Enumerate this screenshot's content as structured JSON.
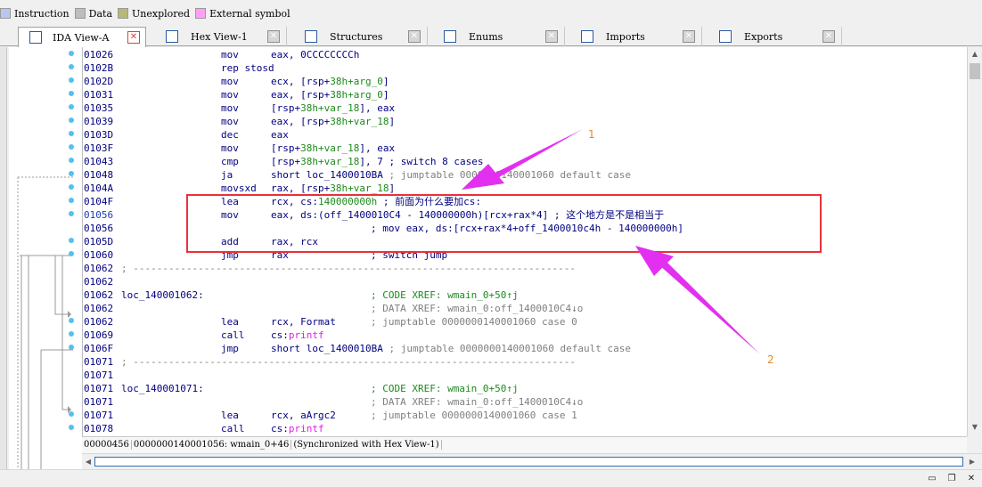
{
  "legend": [
    {
      "label": "Instruction",
      "color": "#b8c6f0"
    },
    {
      "label": "Data",
      "color": "#bdbdbd"
    },
    {
      "label": "Unexplored",
      "color": "#b8b878"
    },
    {
      "label": "External symbol",
      "color": "#ff9ff5"
    }
  ],
  "tabs": [
    {
      "label": "IDA View-A",
      "icon": "listing-icon",
      "active": true
    },
    {
      "label": "Hex View-1",
      "icon": "hex-icon",
      "active": false
    },
    {
      "label": "Structures",
      "icon": "structures-icon",
      "active": false
    },
    {
      "label": "Enums",
      "icon": "enums-icon",
      "active": false
    },
    {
      "label": "Imports",
      "icon": "imports-icon",
      "active": false
    },
    {
      "label": "Exports",
      "icon": "exports-icon",
      "active": false
    }
  ],
  "listing": {
    "rows": [
      {
        "addr": "01026",
        "mnem": "mov",
        "ops": "eax, 0CCCCCCCCh"
      },
      {
        "addr": "0102B",
        "mnem": "rep stosd",
        "ops": ""
      },
      {
        "addr": "0102D",
        "mnem": "mov",
        "ops_pre": "ecx, [rsp+",
        "ops_var": "38h+arg_0",
        "ops_post": "]"
      },
      {
        "addr": "01031",
        "mnem": "mov",
        "ops_pre": "eax, [rsp+",
        "ops_var": "38h+arg_0",
        "ops_post": "]"
      },
      {
        "addr": "01035",
        "mnem": "mov",
        "ops_pre": "[rsp+",
        "ops_var": "38h+var_18",
        "ops_post": "], eax"
      },
      {
        "addr": "01039",
        "mnem": "mov",
        "ops_pre": "eax, [rsp+",
        "ops_var": "38h+var_18",
        "ops_post": "]"
      },
      {
        "addr": "0103D",
        "mnem": "dec",
        "ops": "eax"
      },
      {
        "addr": "0103F",
        "mnem": "mov",
        "ops_pre": "[rsp+",
        "ops_var": "38h+var_18",
        "ops_post": "], eax"
      },
      {
        "addr": "01043",
        "mnem": "cmp",
        "ops_pre": "[rsp+",
        "ops_var": "38h+var_18",
        "ops_post": "], 7",
        "cmt_blue": " ; switch 8 cases"
      },
      {
        "addr": "01048",
        "mnem": "ja",
        "ops": "short loc_1400010BA",
        "cmt": " ; jumptable 0000000140001060 default case"
      },
      {
        "addr": "0104A",
        "mnem": "movsxd",
        "ops_pre": "rax, [rsp+",
        "ops_var": "38h+var_18",
        "ops_post": "]"
      },
      {
        "addr": "0104F",
        "mnem": "lea",
        "ops_pre": "rcx, cs:",
        "ops_var": "140000000h",
        "ops_post": "",
        "cmt_blue": " ; 前面为什么要加cs:"
      },
      {
        "addr": "01056",
        "mnem": "mov",
        "ops": "eax, ds:(off_1400010C4 - 140000000h)[rcx+rax*4]",
        "cmt_blue": " ; 这个地方是不是相当于",
        "hl": true
      },
      {
        "addr": "01056",
        "mnem": "",
        "ops": "",
        "cmt_blue_far": "; mov eax, ds:[rcx+rax*4+off_1400010c4h - 140000000h]"
      },
      {
        "addr": "0105D",
        "mnem": "add",
        "ops": "rax, rcx"
      },
      {
        "addr": "01060",
        "mnem": "jmp",
        "ops": "rax",
        "cmt_far": "; switch jump"
      },
      {
        "addr": "01062",
        "sep": "; ---------------------------------------------------------------------------"
      },
      {
        "addr": "01062",
        "mnem": "",
        "ops": ""
      },
      {
        "addr": "01062",
        "loc": "loc_140001062:",
        "xref_far": "; CODE XREF: wmain_0+50↑j"
      },
      {
        "addr": "01062",
        "cmt_far": "; DATA XREF: wmain_0:off_1400010C4↓o"
      },
      {
        "addr": "01062",
        "mnem": "lea",
        "ops": "rcx, Format",
        "cmt_far": "; jumptable 0000000140001060 case 0"
      },
      {
        "addr": "01069",
        "mnem": "call",
        "ops_pre": "cs:",
        "ops_imp": "printf"
      },
      {
        "addr": "0106F",
        "mnem": "jmp",
        "ops": "short loc_1400010BA",
        "cmt": " ; jumptable 0000000140001060 default case"
      },
      {
        "addr": "01071",
        "sep": "; ---------------------------------------------------------------------------"
      },
      {
        "addr": "01071",
        "mnem": "",
        "ops": ""
      },
      {
        "addr": "01071",
        "loc": "loc_140001071:",
        "xref_far": "; CODE XREF: wmain_0+50↑j"
      },
      {
        "addr": "01071",
        "cmt_far": "; DATA XREF: wmain_0:off_1400010C4↓o"
      },
      {
        "addr": "01071",
        "mnem": "lea",
        "ops": "rcx, aArgc2",
        "cmt_far": "; jumptable 0000000140001060 case 1"
      },
      {
        "addr": "01078",
        "mnem": "call",
        "ops_pre": "cs:",
        "ops_imp": "printf"
      }
    ]
  },
  "status": {
    "offset": "00000456",
    "location": "0000000140001056: wmain_0+46",
    "sync": "(Synchronized with Hex View-1)"
  },
  "annotations": {
    "label1": "1",
    "label2": "2",
    "highlight_color": "#e8323a",
    "arrow_color": "#e32ff0"
  }
}
